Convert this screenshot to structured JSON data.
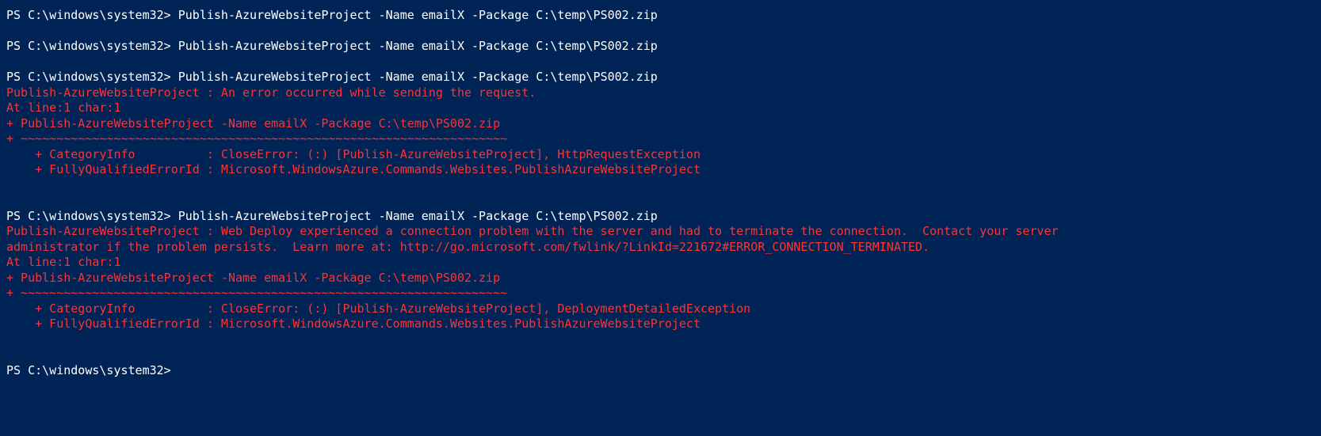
{
  "terminal": {
    "lines": [
      {
        "type": "command",
        "prompt": "PS C:\\windows\\system32> ",
        "text": "Publish-AzureWebsiteProject -Name emailX -Package C:\\temp\\PS002.zip"
      },
      {
        "type": "spacer"
      },
      {
        "type": "command",
        "prompt": "PS C:\\windows\\system32> ",
        "text": "Publish-AzureWebsiteProject -Name emailX -Package C:\\temp\\PS002.zip"
      },
      {
        "type": "spacer"
      },
      {
        "type": "command",
        "prompt": "PS C:\\windows\\system32> ",
        "text": "Publish-AzureWebsiteProject -Name emailX -Package C:\\temp\\PS002.zip"
      },
      {
        "type": "error",
        "text": "Publish-AzureWebsiteProject : An error occurred while sending the request."
      },
      {
        "type": "error",
        "text": "At line:1 char:1"
      },
      {
        "type": "error",
        "text": "+ Publish-AzureWebsiteProject -Name emailX -Package C:\\temp\\PS002.zip"
      },
      {
        "type": "error",
        "text": "+ ~~~~~~~~~~~~~~~~~~~~~~~~~~~~~~~~~~~~~~~~~~~~~~~~~~~~~~~~~~~~~~~~~~~~"
      },
      {
        "type": "error",
        "text": "    + CategoryInfo          : CloseError: (:) [Publish-AzureWebsiteProject], HttpRequestException"
      },
      {
        "type": "error",
        "text": "    + FullyQualifiedErrorId : Microsoft.WindowsAzure.Commands.Websites.PublishAzureWebsiteProject"
      },
      {
        "type": "spacer"
      },
      {
        "type": "spacer"
      },
      {
        "type": "command",
        "prompt": "PS C:\\windows\\system32> ",
        "text": "Publish-AzureWebsiteProject -Name emailX -Package C:\\temp\\PS002.zip"
      },
      {
        "type": "error",
        "text": "Publish-AzureWebsiteProject : Web Deploy experienced a connection problem with the server and had to terminate the connection.  Contact your server"
      },
      {
        "type": "error",
        "text": "administrator if the problem persists.  Learn more at: http://go.microsoft.com/fwlink/?LinkId=221672#ERROR_CONNECTION_TERMINATED."
      },
      {
        "type": "error",
        "text": "At line:1 char:1"
      },
      {
        "type": "error",
        "text": "+ Publish-AzureWebsiteProject -Name emailX -Package C:\\temp\\PS002.zip"
      },
      {
        "type": "error",
        "text": "+ ~~~~~~~~~~~~~~~~~~~~~~~~~~~~~~~~~~~~~~~~~~~~~~~~~~~~~~~~~~~~~~~~~~~~"
      },
      {
        "type": "error",
        "text": "    + CategoryInfo          : CloseError: (:) [Publish-AzureWebsiteProject], DeploymentDetailedException"
      },
      {
        "type": "error",
        "text": "    + FullyQualifiedErrorId : Microsoft.WindowsAzure.Commands.Websites.PublishAzureWebsiteProject"
      },
      {
        "type": "spacer"
      },
      {
        "type": "spacer"
      },
      {
        "type": "command",
        "prompt": "PS C:\\windows\\system32> ",
        "text": ""
      }
    ]
  }
}
